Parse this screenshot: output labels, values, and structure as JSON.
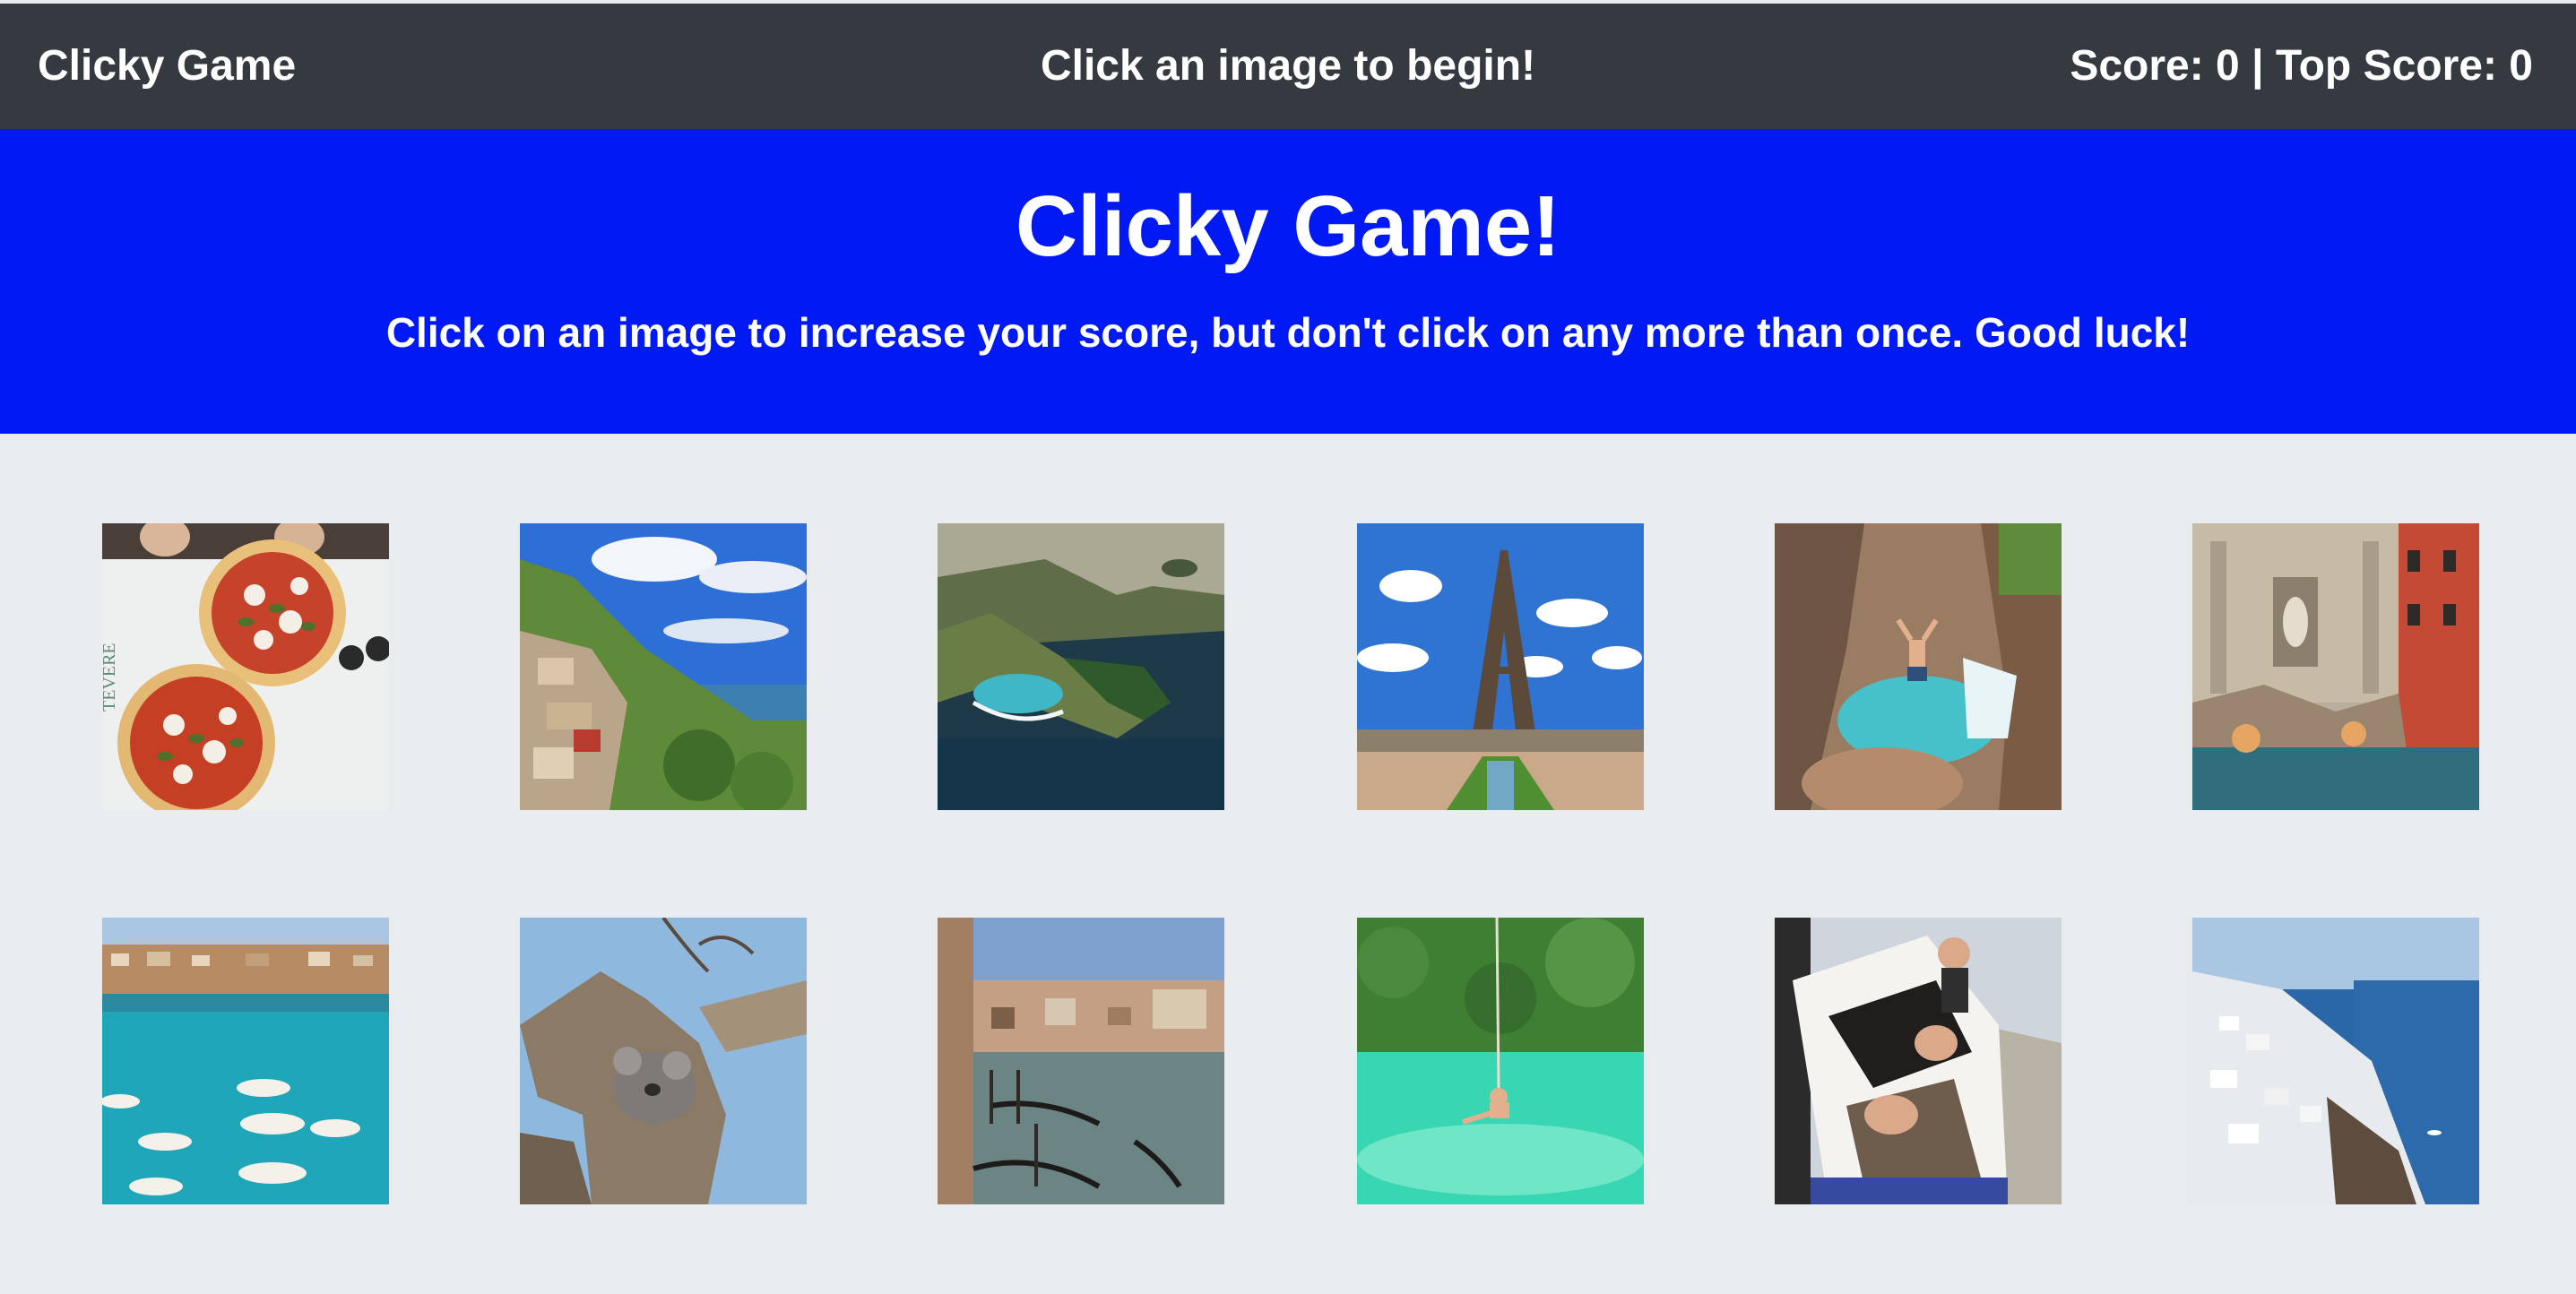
{
  "navbar": {
    "brand": "Clicky Game",
    "message": "Click an image to begin!",
    "score_text": "Score: 0 | Top Score: 0"
  },
  "header": {
    "title": "Clicky Game!",
    "subtitle": "Click on an image to increase your score, but don't click on any more than once. Good luck!"
  },
  "colors": {
    "navbar_bg": "#343a40",
    "jumbotron_bg": "#0019f5",
    "page_bg": "#e9ecef"
  },
  "images": [
    {
      "name": "pizza-image",
      "depicts": "pizza"
    },
    {
      "name": "coastal-village-image",
      "depicts": "coastal village"
    },
    {
      "name": "island-cliffs-image",
      "depicts": "island cliffs"
    },
    {
      "name": "eiffel-tower-image",
      "depicts": "eiffel tower"
    },
    {
      "name": "waterfall-jump-image",
      "depicts": "waterfall jump"
    },
    {
      "name": "trevi-fountain-image",
      "depicts": "trevi fountain"
    },
    {
      "name": "harbor-boats-image",
      "depicts": "harbor boats"
    },
    {
      "name": "koala-tree-image",
      "depicts": "koala in tree"
    },
    {
      "name": "venice-canal-image",
      "depicts": "venice canal"
    },
    {
      "name": "rope-swing-image",
      "depicts": "rope swing lagoon"
    },
    {
      "name": "camper-van-image",
      "depicts": "camper van"
    },
    {
      "name": "santorini-image",
      "depicts": "santorini"
    }
  ]
}
